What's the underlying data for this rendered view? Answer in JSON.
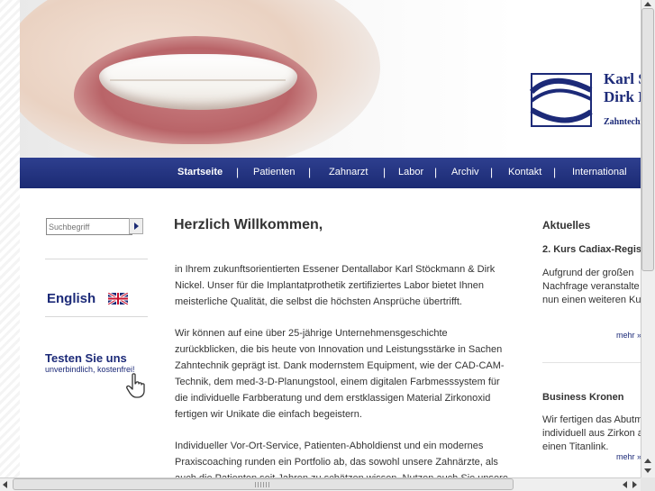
{
  "colors": {
    "brand": "#1c2a78",
    "nav_bg": "#1b2a73",
    "text": "#333333"
  },
  "header": {
    "brand_line1": "Karl S",
    "brand_line2": "Dirk N",
    "brand_line3": "Zahntechn"
  },
  "nav": {
    "items": [
      {
        "label": "Startseite",
        "active": true
      },
      {
        "label": "Patienten"
      },
      {
        "label": "Zahnarzt"
      },
      {
        "label": "Labor"
      },
      {
        "label": "Archiv"
      },
      {
        "label": "Kontakt"
      },
      {
        "label": "International"
      }
    ],
    "separator": "|"
  },
  "sidebar": {
    "search_placeholder": "Suchbegriff",
    "search_icon": "play-triangle-icon",
    "english_label": "English",
    "flag_icon": "uk-flag-icon",
    "testen_title": "Testen Sie uns",
    "testen_sub": "unverbindlich, kostenfrei!",
    "hand_icon": "pointing-hand-icon"
  },
  "main": {
    "title": "Herzlich Willkommen,",
    "paragraphs": [
      "in Ihrem zukunftsorientierten Essener Dentallabor Karl Stöckmann & Dirk Nickel. Unser für die Implantatprothetik zertifiziertes Labor bietet Ihnen meisterliche Qualität, die selbst die höchsten Ansprüche übertrifft.",
      "Wir können auf eine über 25-jährige Unternehmensgeschichte zurückblicken, die bis heute von Innovation und Leistungsstärke in Sachen Zahntechnik geprägt ist. Dank modernstem Equipment, wie der CAD-CAM-Technik, dem med-3-D-Planungstool, einem digitalen Farbmesssystem für die individuelle Farbberatung und dem erstklassigen Material Zirkonoxid fertigen wir Unikate die einfach begeistern.",
      "Individueller Vor-Ort-Service, Patienten-Abholdienst und ein modernes Praxiscoaching runden ein Portfolio ab, das sowohl unsere Zahnärzte, als auch die Patienten seit Jahren zu schätzen wissen. Nutzen auch Sie unsere"
    ]
  },
  "news": {
    "heading": "Aktuelles",
    "items": [
      {
        "title": "2. Kurs Cadiax-Regis",
        "lines": [
          "Aufgrund der großen",
          "Nachfrage veranstalte",
          "nun einen weiteren Ku"
        ],
        "more": "mehr »"
      },
      {
        "title": "Business Kronen",
        "lines": [
          "Wir fertigen das Abutm",
          "individuell aus Zirkon a",
          "einen Titanlink."
        ],
        "more": "mehr »"
      }
    ]
  }
}
